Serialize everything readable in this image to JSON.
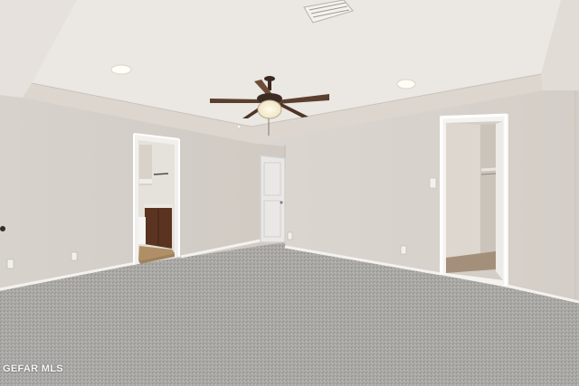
{
  "photo": {
    "watermark": "GEFAR MLS",
    "colors": {
      "ceiling": "#eae6e1",
      "wall": "#d9d4ce",
      "wall_shadow": "#cdc7c0",
      "carpet": "#a9a7a4",
      "baseboard": "#f4f2ef",
      "door": "#e9e8e6",
      "fan_blade": "#5b3f2e",
      "vanity": "#5a3420"
    }
  }
}
